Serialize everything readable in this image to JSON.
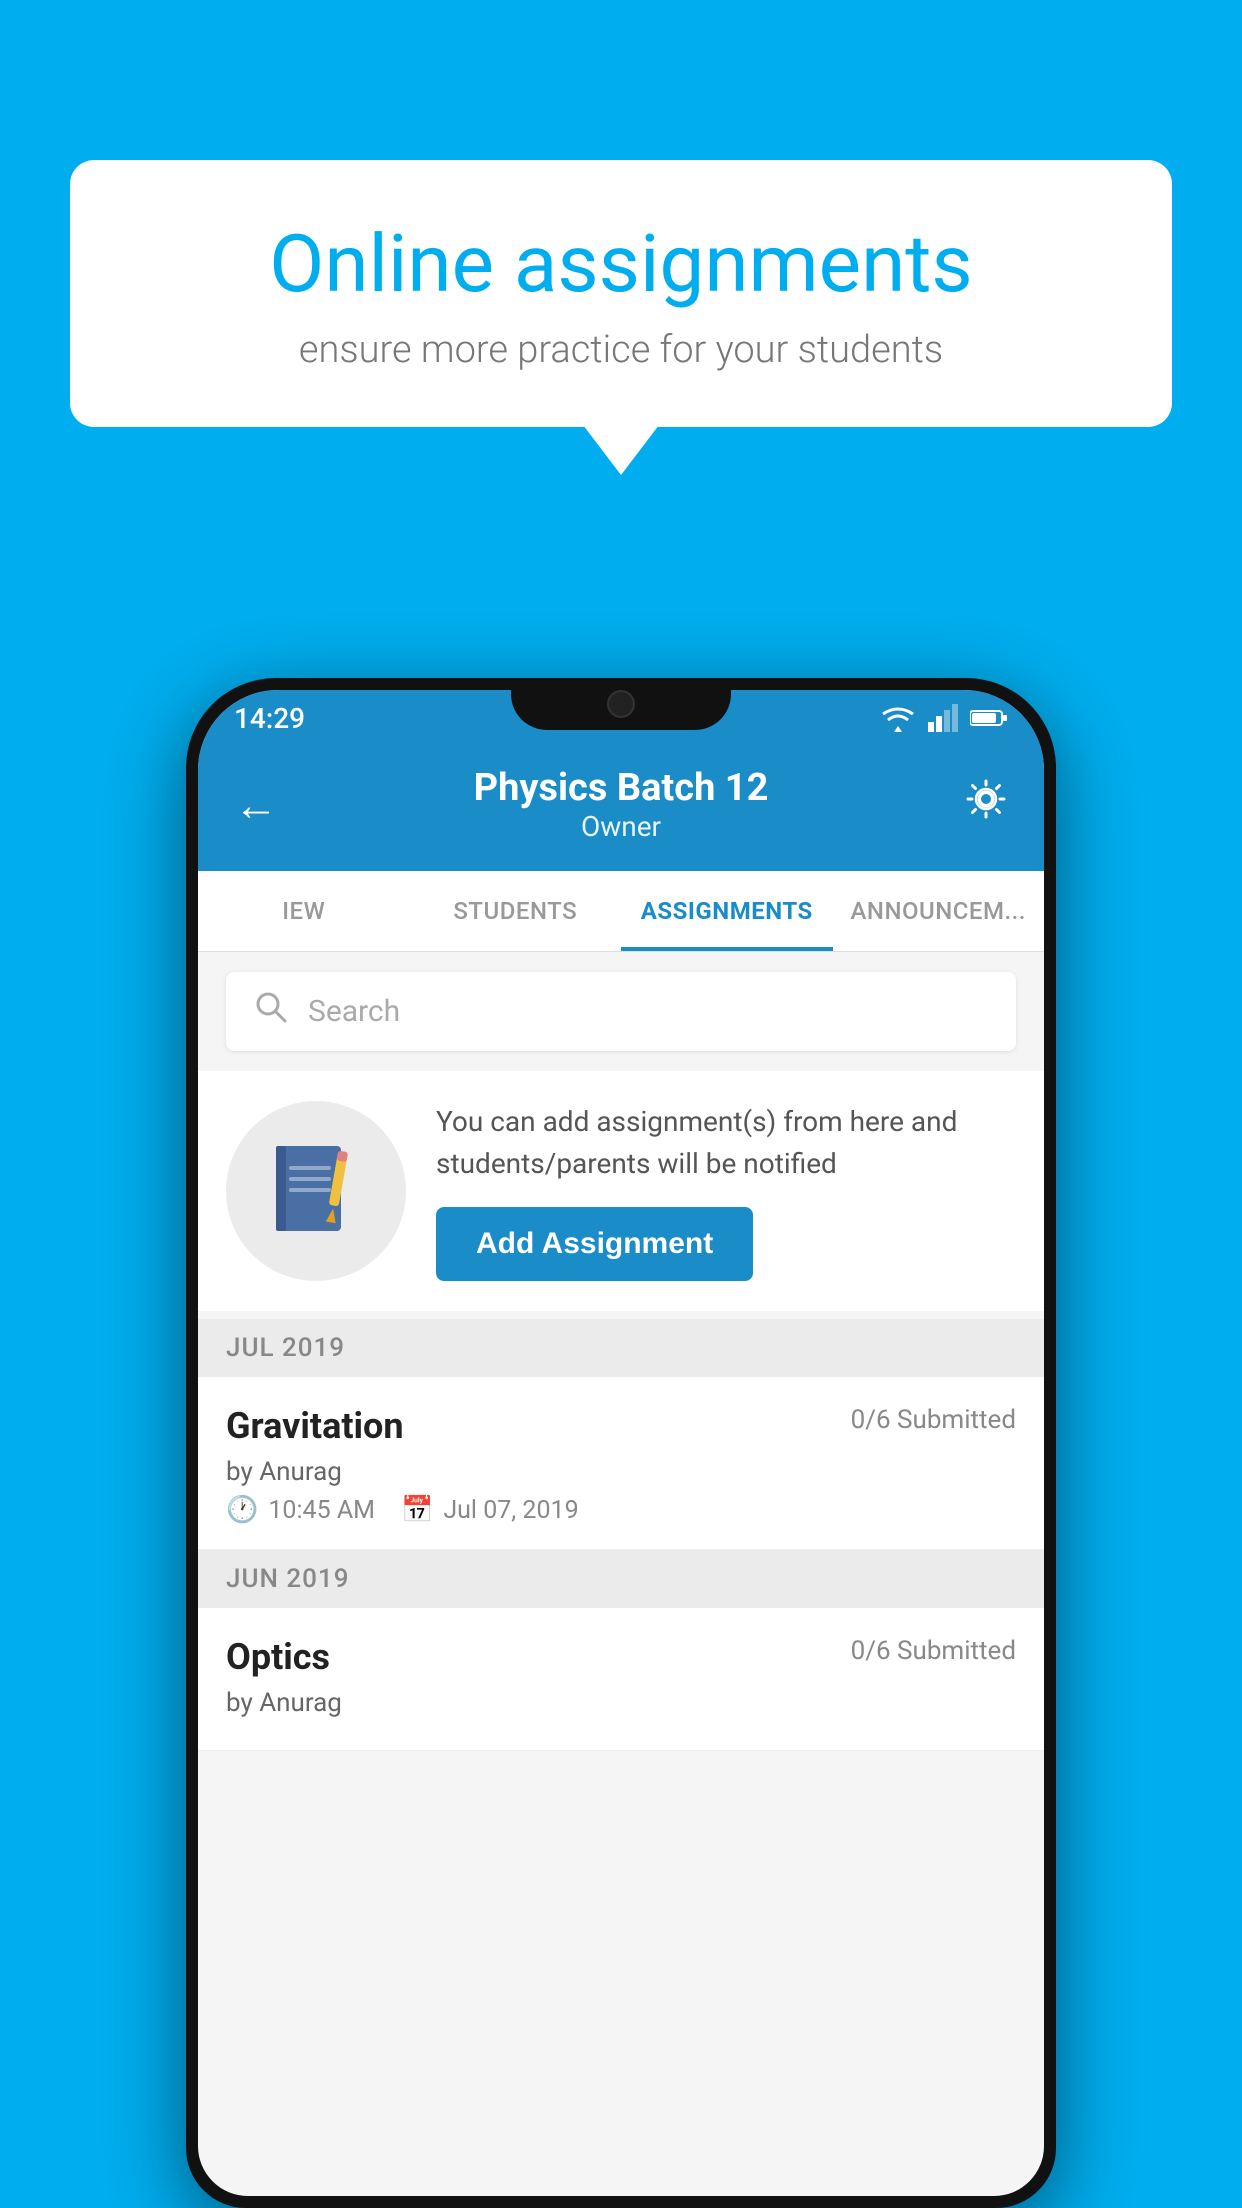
{
  "background_color": "#00AEEF",
  "speech_bubble": {
    "title": "Online assignments",
    "subtitle": "ensure more practice for your students"
  },
  "phone": {
    "status_bar": {
      "time": "14:29"
    },
    "header": {
      "title": "Physics Batch 12",
      "subtitle": "Owner",
      "back_label": "←",
      "settings_label": "⚙"
    },
    "tabs": [
      {
        "label": "IEW",
        "active": false
      },
      {
        "label": "STUDENTS",
        "active": false
      },
      {
        "label": "ASSIGNMENTS",
        "active": true
      },
      {
        "label": "ANNOUNCEM...",
        "active": false
      }
    ],
    "search": {
      "placeholder": "Search"
    },
    "prompt": {
      "text": "You can add assignment(s) from here and students/parents will be notified",
      "button_label": "Add Assignment"
    },
    "month_sections": [
      {
        "month": "JUL 2019",
        "assignments": [
          {
            "name": "Gravitation",
            "status": "0/6 Submitted",
            "by": "by Anurag",
            "time": "10:45 AM",
            "date": "Jul 07, 2019"
          }
        ]
      },
      {
        "month": "JUN 2019",
        "assignments": [
          {
            "name": "Optics",
            "status": "0/6 Submitted",
            "by": "by Anurag",
            "time": "",
            "date": ""
          }
        ]
      }
    ]
  }
}
